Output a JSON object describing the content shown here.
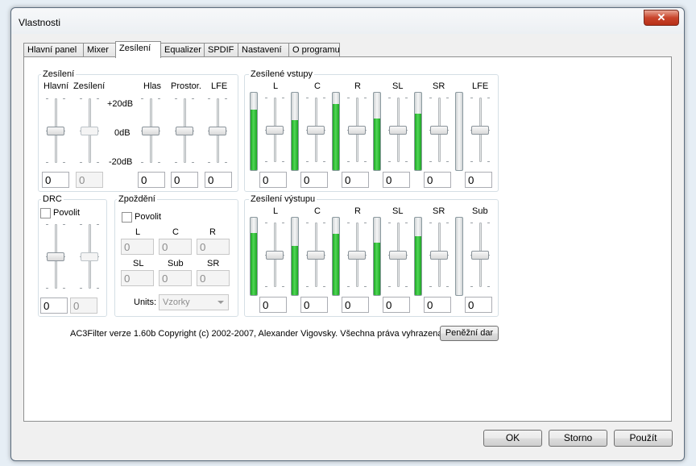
{
  "window": {
    "title": "Vlastnosti",
    "close_glyph": "✕"
  },
  "tabs": [
    "Hlavní panel",
    "Mixer",
    "Zesílení",
    "Equalizer",
    "SPDIF",
    "Nastavení",
    "O programu"
  ],
  "active_tab": "Zesílení",
  "gain": {
    "group_label": "Zesílení",
    "col_labels": {
      "master": "Hlavní",
      "gain": "Zesílení",
      "voice": "Hlas",
      "surround": "Prostor.",
      "lfe": "LFE"
    },
    "scale_labels": [
      "+20dB",
      "0dB",
      "-20dB"
    ],
    "values": {
      "master": "0",
      "gain": "0",
      "voice": "0",
      "surround": "0",
      "lfe": "0"
    },
    "slider_levels": {
      "master": 0.5,
      "gain": 0.5,
      "voice": 0.5,
      "surround": 0.5,
      "lfe": 0.5
    }
  },
  "input_gains": {
    "group_label": "Zesílené vstupy",
    "channels": [
      {
        "label": "L",
        "value": "0",
        "level": 0.78,
        "slider": 0.5
      },
      {
        "label": "C",
        "value": "0",
        "level": 0.65,
        "slider": 0.5
      },
      {
        "label": "R",
        "value": "0",
        "level": 0.85,
        "slider": 0.5
      },
      {
        "label": "SL",
        "value": "0",
        "level": 0.67,
        "slider": 0.5
      },
      {
        "label": "SR",
        "value": "0",
        "level": 0.73,
        "slider": 0.5
      },
      {
        "label": "LFE",
        "value": "0",
        "level": 0.0,
        "slider": 0.5
      }
    ]
  },
  "output_gains": {
    "group_label": "Zesílení výstupu",
    "channels": [
      {
        "label": "L",
        "value": "0",
        "level": 0.8,
        "slider": 0.5
      },
      {
        "label": "C",
        "value": "0",
        "level": 0.64,
        "slider": 0.5
      },
      {
        "label": "R",
        "value": "0",
        "level": 0.79,
        "slider": 0.5
      },
      {
        "label": "SL",
        "value": "0",
        "level": 0.68,
        "slider": 0.5
      },
      {
        "label": "SR",
        "value": "0",
        "level": 0.76,
        "slider": 0.5
      },
      {
        "label": "Sub",
        "value": "0",
        "level": 0.0,
        "slider": 0.5
      }
    ]
  },
  "drc": {
    "group_label": "DRC",
    "enable_label": "Povolit",
    "enabled": false,
    "values": [
      "0",
      "0"
    ],
    "slider_levels": [
      0.5,
      0.5
    ]
  },
  "delay": {
    "group_label": "Zpoždění",
    "enable_label": "Povolit",
    "enabled": false,
    "fields": [
      {
        "label": "L",
        "value": "0"
      },
      {
        "label": "C",
        "value": "0"
      },
      {
        "label": "R",
        "value": "0"
      },
      {
        "label": "SL",
        "value": "0"
      },
      {
        "label": "Sub",
        "value": "0"
      },
      {
        "label": "SR",
        "value": "0"
      }
    ],
    "units_label": "Units:",
    "units_value": "Vzorky"
  },
  "footer": {
    "copyright": "AC3Filter verze 1.60b Copyright (c) 2002-2007, Alexander Vigovsky. Všechna práva vyhrazena.",
    "donate_label": "Peněžní dar"
  },
  "buttons": {
    "ok": "OK",
    "cancel": "Storno",
    "apply": "Použít"
  }
}
